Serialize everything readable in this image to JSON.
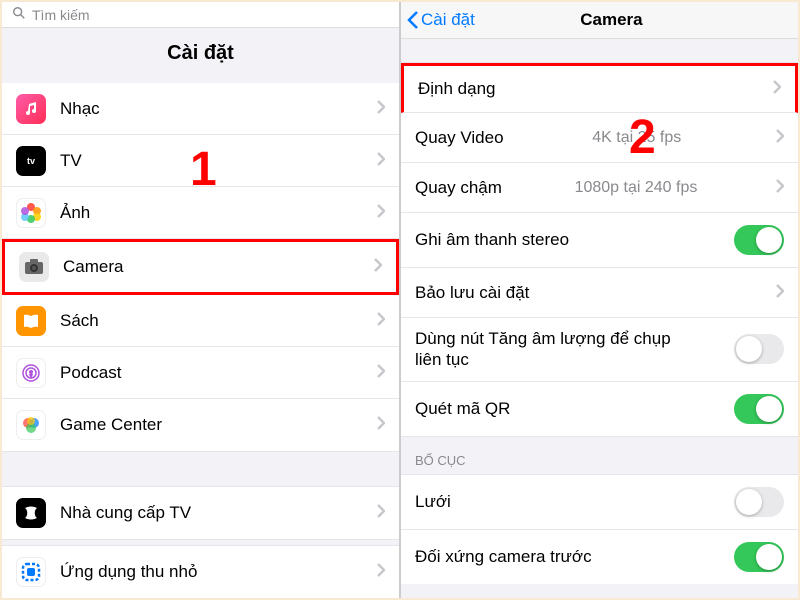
{
  "left": {
    "search_placeholder": "Tìm kiếm",
    "title": "Cài đặt",
    "items": [
      {
        "name": "music",
        "label": "Nhạc"
      },
      {
        "name": "tv",
        "label": "TV"
      },
      {
        "name": "photos",
        "label": "Ảnh"
      },
      {
        "name": "camera",
        "label": "Camera",
        "highlight": true
      },
      {
        "name": "books",
        "label": "Sách"
      },
      {
        "name": "podcast",
        "label": "Podcast"
      },
      {
        "name": "gamecenter",
        "label": "Game Center"
      }
    ],
    "group2": [
      {
        "name": "tvprovider",
        "label": "Nhà cung cấp TV"
      }
    ],
    "group3": [
      {
        "name": "widgets",
        "label": "Ứng dụng thu nhỏ"
      }
    ],
    "callout": "1"
  },
  "right": {
    "back_label": "Cài đặt",
    "title": "Camera",
    "rows": [
      {
        "name": "formats",
        "label": "Định dạng",
        "type": "nav",
        "highlight": true
      },
      {
        "name": "record-video",
        "label": "Quay Video",
        "type": "value",
        "value": "4K tại 25 fps"
      },
      {
        "name": "record-slomo",
        "label": "Quay chậm",
        "type": "value",
        "value": "1080p tại 240 fps"
      },
      {
        "name": "stereo",
        "label": "Ghi âm thanh stereo",
        "type": "toggle",
        "on": true
      },
      {
        "name": "preserve",
        "label": "Bảo lưu cài đặt",
        "type": "nav"
      },
      {
        "name": "burst",
        "label": "Dùng nút Tăng âm lượng để chụp liên tục",
        "type": "toggle",
        "on": false,
        "multiline": true
      },
      {
        "name": "qr",
        "label": "Quét mã QR",
        "type": "toggle",
        "on": true
      }
    ],
    "section_header": "BỐ CỤC",
    "rows2": [
      {
        "name": "grid",
        "label": "Lưới",
        "type": "toggle",
        "on": false
      },
      {
        "name": "mirror",
        "label": "Đối xứng camera trước",
        "type": "toggle",
        "on": true
      }
    ],
    "callout": "2"
  }
}
